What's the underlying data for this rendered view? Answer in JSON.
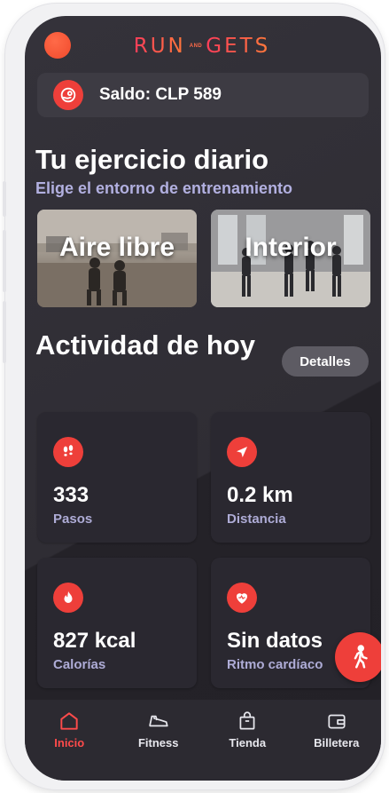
{
  "header": {
    "logo_text_1": "RUN",
    "logo_and": "AND",
    "logo_text_2": "GETS"
  },
  "balance": {
    "text": "Saldo: CLP 589"
  },
  "exercise": {
    "title": "Tu ejercicio diario",
    "subtitle": "Elige el entorno de entrenamiento",
    "environments": [
      {
        "label": "Aire libre"
      },
      {
        "label": "Interior"
      }
    ]
  },
  "activity": {
    "title": "Actividad de hoy",
    "details_label": "Detalles",
    "stats": [
      {
        "value": "333",
        "label": "Pasos",
        "icon": "footprints-icon"
      },
      {
        "value": "0.2 km",
        "label": "Distancia",
        "icon": "navigation-arrow-icon"
      },
      {
        "value": "827 kcal",
        "label": "Calorías",
        "icon": "flame-icon"
      },
      {
        "value": "Sin datos",
        "label": "Ritmo cardíaco",
        "icon": "heart-pulse-icon"
      }
    ]
  },
  "tabs": [
    {
      "label": "Inicio",
      "icon": "home-icon",
      "active": true
    },
    {
      "label": "Fitness",
      "icon": "shoe-icon",
      "active": false
    },
    {
      "label": "Tienda",
      "icon": "shopping-bag-icon",
      "active": false
    },
    {
      "label": "Billetera",
      "icon": "wallet-icon",
      "active": false
    }
  ],
  "colors": {
    "accent": "#ee3f3a",
    "background": "#2f2d34",
    "subtitle": "#b2b0e0"
  }
}
